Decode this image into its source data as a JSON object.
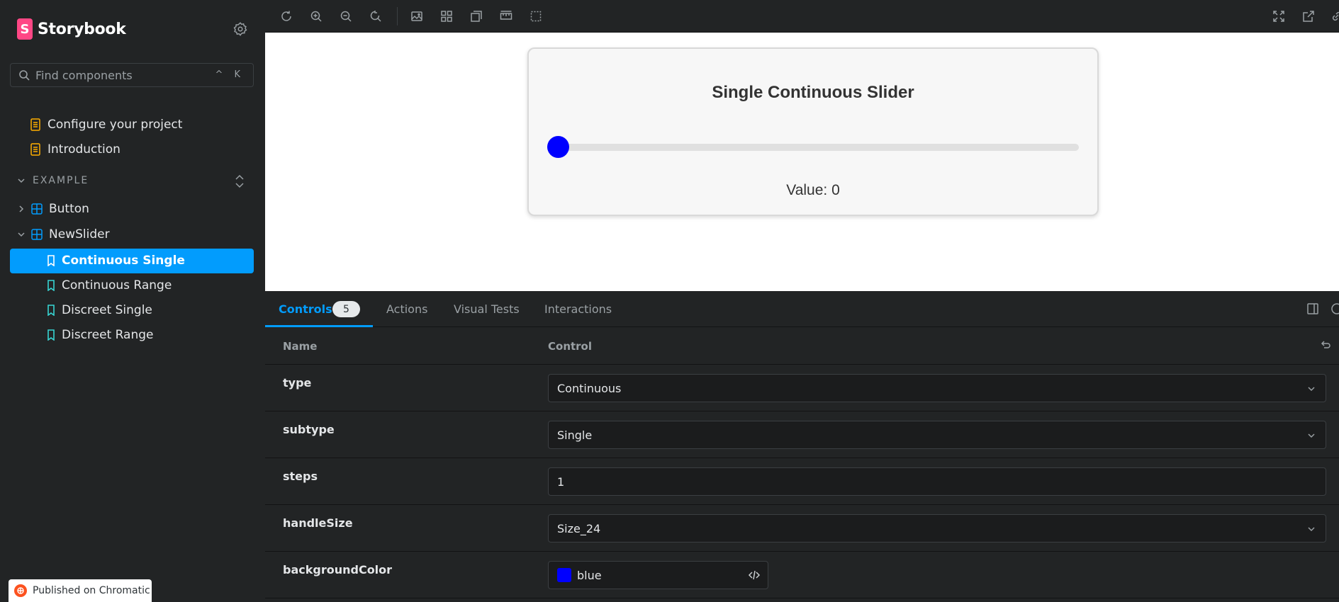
{
  "sidebar": {
    "brand": "Storybook",
    "search_placeholder": "Find components",
    "shortcut": "^ K",
    "docs": [
      {
        "label": "Configure your project"
      },
      {
        "label": "Introduction"
      }
    ],
    "section": "EXAMPLE",
    "components": [
      {
        "label": "Button"
      },
      {
        "label": "NewSlider"
      }
    ],
    "stories": [
      {
        "label": "Continuous Single"
      },
      {
        "label": "Continuous Range"
      },
      {
        "label": "Discreet Single"
      },
      {
        "label": "Discreet Range"
      }
    ],
    "chromatic": "Published on Chromatic"
  },
  "preview": {
    "title": "Single Continuous Slider",
    "value_text": "Value: 0",
    "slider_value": 0,
    "thumb_color": "#0000ff"
  },
  "panel": {
    "tabs": [
      {
        "label": "Controls",
        "badge": "5"
      },
      {
        "label": "Actions"
      },
      {
        "label": "Visual Tests"
      },
      {
        "label": "Interactions"
      }
    ],
    "col_name": "Name",
    "col_control": "Control",
    "rows": [
      {
        "name": "type",
        "value": "Continuous"
      },
      {
        "name": "subtype",
        "value": "Single"
      },
      {
        "name": "steps",
        "value": "1"
      },
      {
        "name": "handleSize",
        "value": "Size_24"
      },
      {
        "name": "backgroundColor",
        "value": "blue"
      }
    ]
  },
  "colors": {
    "accent": "#029cfd",
    "storybook_pink": "#ff4785"
  }
}
